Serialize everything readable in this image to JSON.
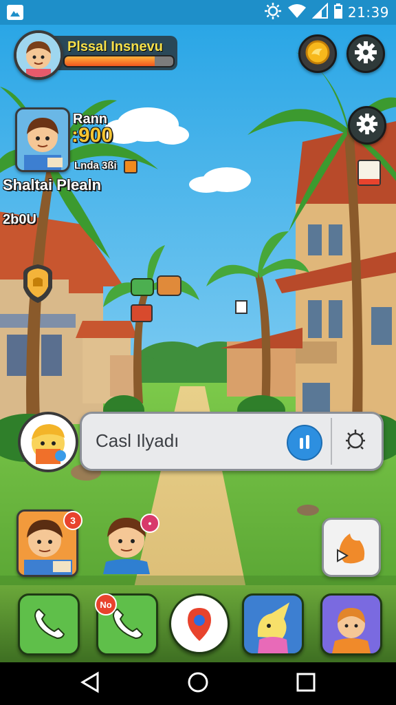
{
  "status_bar": {
    "time": "21:39",
    "icons": [
      "app-notification-icon",
      "brightness-icon",
      "wifi-icon",
      "signal-icon",
      "battery-icon"
    ]
  },
  "player": {
    "name": "Plssal Insnevu",
    "health_fraction": 0.83
  },
  "hud": {
    "character_label": "Rann",
    "score": ":900",
    "level_line": "Lnda 3ßi",
    "location": "Shaltai Plealn",
    "counter": "2b0U"
  },
  "chat": {
    "message": "Casl Ilyadı",
    "info_icon": "info-icon",
    "bug_icon": "bug-icon"
  },
  "party": {
    "member1_badge": "3",
    "member2_badge": "•"
  },
  "dock": {
    "badge": "No",
    "items": [
      "phone-icon",
      "phone-icon",
      "map-pin-icon",
      "character-card",
      "character-card"
    ]
  },
  "colors": {
    "status_bar": "#1e8fc9",
    "accent_green": "#4caf50",
    "health_fill": "#f0561e"
  }
}
